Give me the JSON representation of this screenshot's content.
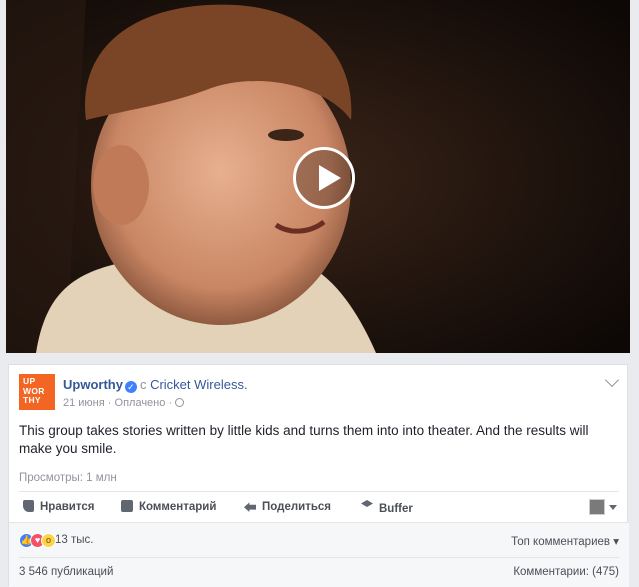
{
  "video": {
    "play_icon": "play-icon"
  },
  "post": {
    "page_name": "Upworthy",
    "logo_lines": [
      "UP",
      "WOR",
      "THY"
    ],
    "with_text": "с",
    "partner_name": "Cricket Wireless.",
    "date": "21 июня",
    "sponsored": "Оплачено",
    "separator": "·",
    "text": "This group takes stories written by little kids and turns them into into theater. And the results will make you smile.",
    "views": "Просмотры: 1 млн"
  },
  "actions": {
    "like": "Нравится",
    "comment": "Комментарий",
    "share": "Поделиться",
    "buffer": "Buffer"
  },
  "footer": {
    "reaction_count": "13 тыс.",
    "top_comments": "Топ комментариев",
    "shares": "3 546 публикаций",
    "comments": "Комментарии: (475)"
  },
  "colors": {
    "brand": "#f26522",
    "link": "#365899",
    "accent": "#4080ff"
  }
}
